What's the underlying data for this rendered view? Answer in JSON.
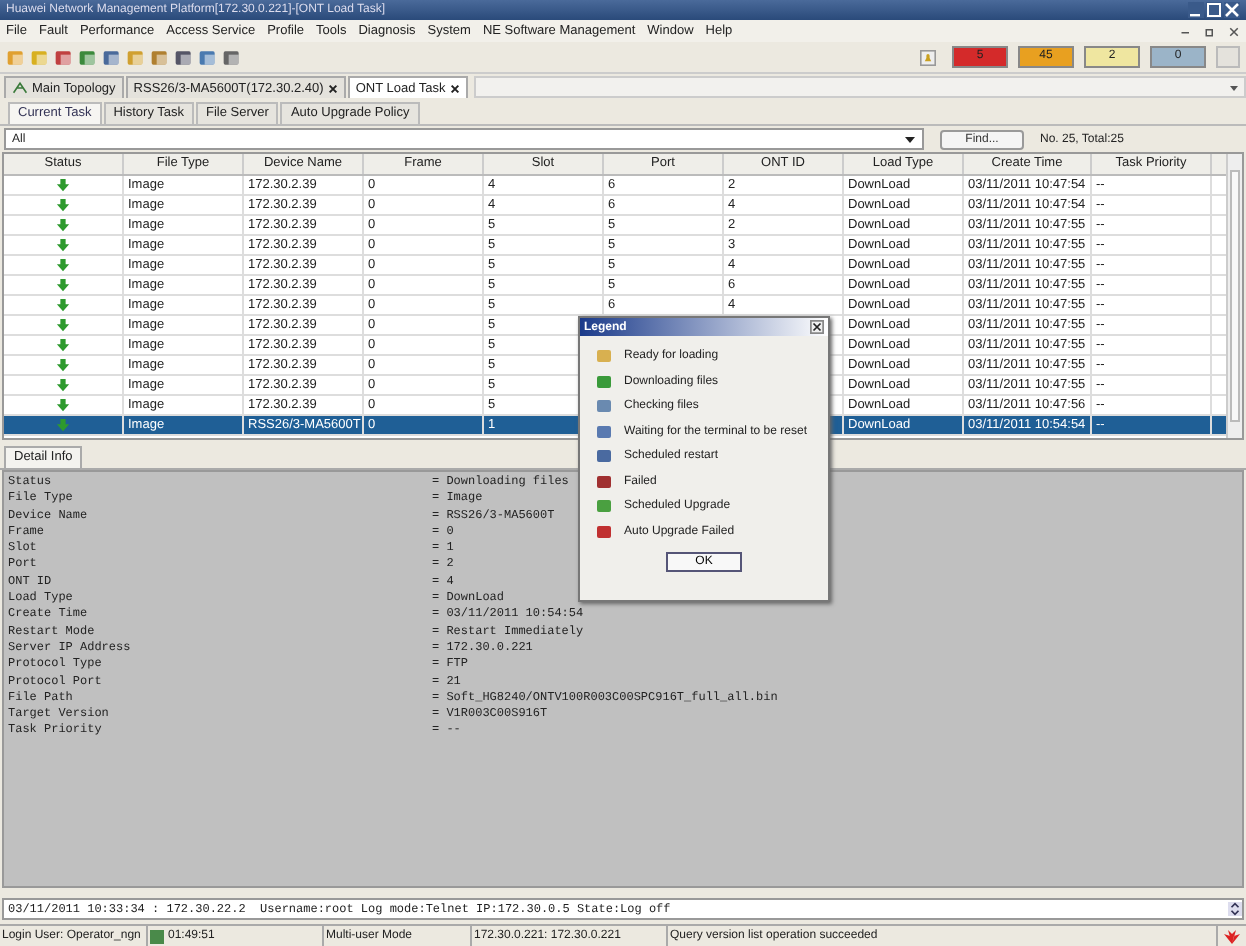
{
  "window": {
    "title": "Huawei Network Management Platform[172.30.0.221]-[ONT Load Task]"
  },
  "menu": [
    "File",
    "Fault",
    "Performance",
    "Access Service",
    "Profile",
    "Tools",
    "Diagnosis",
    "System",
    "NE Software Management",
    "Window",
    "Help"
  ],
  "alarms": [
    {
      "count": "5",
      "color": "#d42a2a"
    },
    {
      "count": "45",
      "color": "#e8a020"
    },
    {
      "count": "2",
      "color": "#efe6a0"
    },
    {
      "count": "0",
      "color": "#9bb4c8"
    }
  ],
  "view_tabs": [
    {
      "label": "Main Topology",
      "closable": false,
      "selected": false
    },
    {
      "label": "RSS26/3-MA5600T(172.30.2.40)",
      "closable": true,
      "selected": false
    },
    {
      "label": "ONT Load Task",
      "closable": true,
      "selected": true
    }
  ],
  "task_tabs": [
    {
      "label": "Current Task",
      "selected": true
    },
    {
      "label": "History Task",
      "selected": false
    },
    {
      "label": "File Server",
      "selected": false
    },
    {
      "label": "Auto Upgrade Policy",
      "selected": false
    }
  ],
  "filter": {
    "value": "All",
    "find_button": "Find...",
    "count": "No. 25, Total:25"
  },
  "table": {
    "columns": [
      "Status",
      "File Type",
      "Device Name",
      "Frame",
      "Slot",
      "Port",
      "ONT ID",
      "Load Type",
      "Create Time",
      "Task Priority"
    ],
    "rows": [
      {
        "selected": false,
        "cells": [
          "",
          "Image",
          "172.30.2.39",
          "0",
          "4",
          "6",
          "2",
          "DownLoad",
          "03/11/2011 10:47:54",
          "--"
        ]
      },
      {
        "selected": false,
        "cells": [
          "",
          "Image",
          "172.30.2.39",
          "0",
          "4",
          "6",
          "4",
          "DownLoad",
          "03/11/2011 10:47:54",
          "--"
        ]
      },
      {
        "selected": false,
        "cells": [
          "",
          "Image",
          "172.30.2.39",
          "0",
          "5",
          "5",
          "2",
          "DownLoad",
          "03/11/2011 10:47:55",
          "--"
        ]
      },
      {
        "selected": false,
        "cells": [
          "",
          "Image",
          "172.30.2.39",
          "0",
          "5",
          "5",
          "3",
          "DownLoad",
          "03/11/2011 10:47:55",
          "--"
        ]
      },
      {
        "selected": false,
        "cells": [
          "",
          "Image",
          "172.30.2.39",
          "0",
          "5",
          "5",
          "4",
          "DownLoad",
          "03/11/2011 10:47:55",
          "--"
        ]
      },
      {
        "selected": false,
        "cells": [
          "",
          "Image",
          "172.30.2.39",
          "0",
          "5",
          "5",
          "6",
          "DownLoad",
          "03/11/2011 10:47:55",
          "--"
        ]
      },
      {
        "selected": false,
        "cells": [
          "",
          "Image",
          "172.30.2.39",
          "0",
          "5",
          "6",
          "4",
          "DownLoad",
          "03/11/2011 10:47:55",
          "--"
        ]
      },
      {
        "selected": false,
        "cells": [
          "",
          "Image",
          "172.30.2.39",
          "0",
          "5",
          "",
          "",
          "DownLoad",
          "03/11/2011 10:47:55",
          "--"
        ]
      },
      {
        "selected": false,
        "cells": [
          "",
          "Image",
          "172.30.2.39",
          "0",
          "5",
          "",
          "",
          "DownLoad",
          "03/11/2011 10:47:55",
          "--"
        ]
      },
      {
        "selected": false,
        "cells": [
          "",
          "Image",
          "172.30.2.39",
          "0",
          "5",
          "",
          "",
          "DownLoad",
          "03/11/2011 10:47:55",
          "--"
        ]
      },
      {
        "selected": false,
        "cells": [
          "",
          "Image",
          "172.30.2.39",
          "0",
          "5",
          "",
          "",
          "DownLoad",
          "03/11/2011 10:47:55",
          "--"
        ]
      },
      {
        "selected": false,
        "cells": [
          "",
          "Image",
          "172.30.2.39",
          "0",
          "5",
          "",
          "",
          "DownLoad",
          "03/11/2011 10:47:56",
          "--"
        ]
      },
      {
        "selected": true,
        "cells": [
          "",
          "Image",
          "RSS26/3-MA5600T",
          "0",
          "1",
          "",
          "",
          "DownLoad",
          "03/11/2011 10:54:54",
          "--"
        ]
      }
    ]
  },
  "detail": {
    "tab": "Detail Info",
    "fields": [
      {
        "key": "Status",
        "value": "= Downloading files"
      },
      {
        "key": "File Type",
        "value": "= Image"
      },
      {
        "key": "Device Name",
        "value": "= RSS26/3-MA5600T"
      },
      {
        "key": "Frame",
        "value": "= 0"
      },
      {
        "key": "Slot",
        "value": "= 1"
      },
      {
        "key": "Port",
        "value": "= 2"
      },
      {
        "key": "ONT ID",
        "value": "= 4"
      },
      {
        "key": "Load Type",
        "value": "= DownLoad"
      },
      {
        "key": "Create Time",
        "value": "= 03/11/2011 10:54:54"
      },
      {
        "key": "Restart Mode",
        "value": "= Restart Immediately"
      },
      {
        "key": "Server IP Address",
        "value": "= 172.30.0.221"
      },
      {
        "key": "Protocol Type",
        "value": "= FTP"
      },
      {
        "key": "Protocol Port",
        "value": "= 21"
      },
      {
        "key": "File Path",
        "value": "= Soft_HG8240/ONTV100R003C00SPC916T_full_all.bin"
      },
      {
        "key": "Target Version",
        "value": "= V1R003C00S916T"
      },
      {
        "key": "Task Priority",
        "value": "= --"
      }
    ]
  },
  "legend": {
    "title": "Legend",
    "items": [
      "Ready for loading",
      "Downloading files",
      "Checking files",
      "Waiting for the terminal to be reset",
      "Scheduled restart",
      "Failed",
      "Scheduled Upgrade",
      "Auto Upgrade Failed"
    ],
    "ok_button": "OK"
  },
  "log_line": "03/11/2011 10:33:34 : 172.30.22.2  Username:root Log mode:Telnet IP:172.30.0.5 State:Log off",
  "status_bar": {
    "user": "Login User: Operator_ngn",
    "time": "01:49:51",
    "mode": "Multi-user Mode",
    "server": "172.30.0.221: 172.30.0.221",
    "message": "Query version list operation succeeded"
  }
}
